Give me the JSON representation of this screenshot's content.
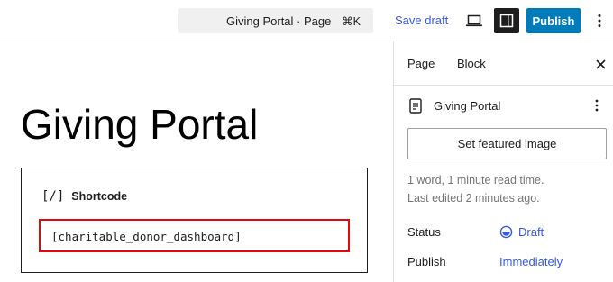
{
  "topbar": {
    "document_title": "Giving Portal · Page",
    "shortcut": "⌘K",
    "save_draft_label": "Save draft",
    "publish_label": "Publish",
    "icons": [
      "laptop-icon",
      "sidebar-icon",
      "more-vertical-icon"
    ],
    "accent_color": "#007cba",
    "link_color": "#3858e9"
  },
  "editor": {
    "post_title": "Giving Portal",
    "shortcode_block": {
      "icon_text": "[/]",
      "label": "Shortcode",
      "value": "[charitable_donor_dashboard]",
      "highlight_color": "#e10a0a"
    }
  },
  "sidebar": {
    "tabs": [
      {
        "label": "Page",
        "active": true
      },
      {
        "label": "Block",
        "active": false
      }
    ],
    "document": {
      "title": "Giving Portal"
    },
    "featured_image_label": "Set featured image",
    "word_count": "1 word, 1 minute read time.",
    "last_edited": "Last edited 2 minutes ago.",
    "properties": [
      {
        "label": "Status",
        "value": "Draft"
      },
      {
        "label": "Publish",
        "value": "Immediately"
      }
    ]
  }
}
